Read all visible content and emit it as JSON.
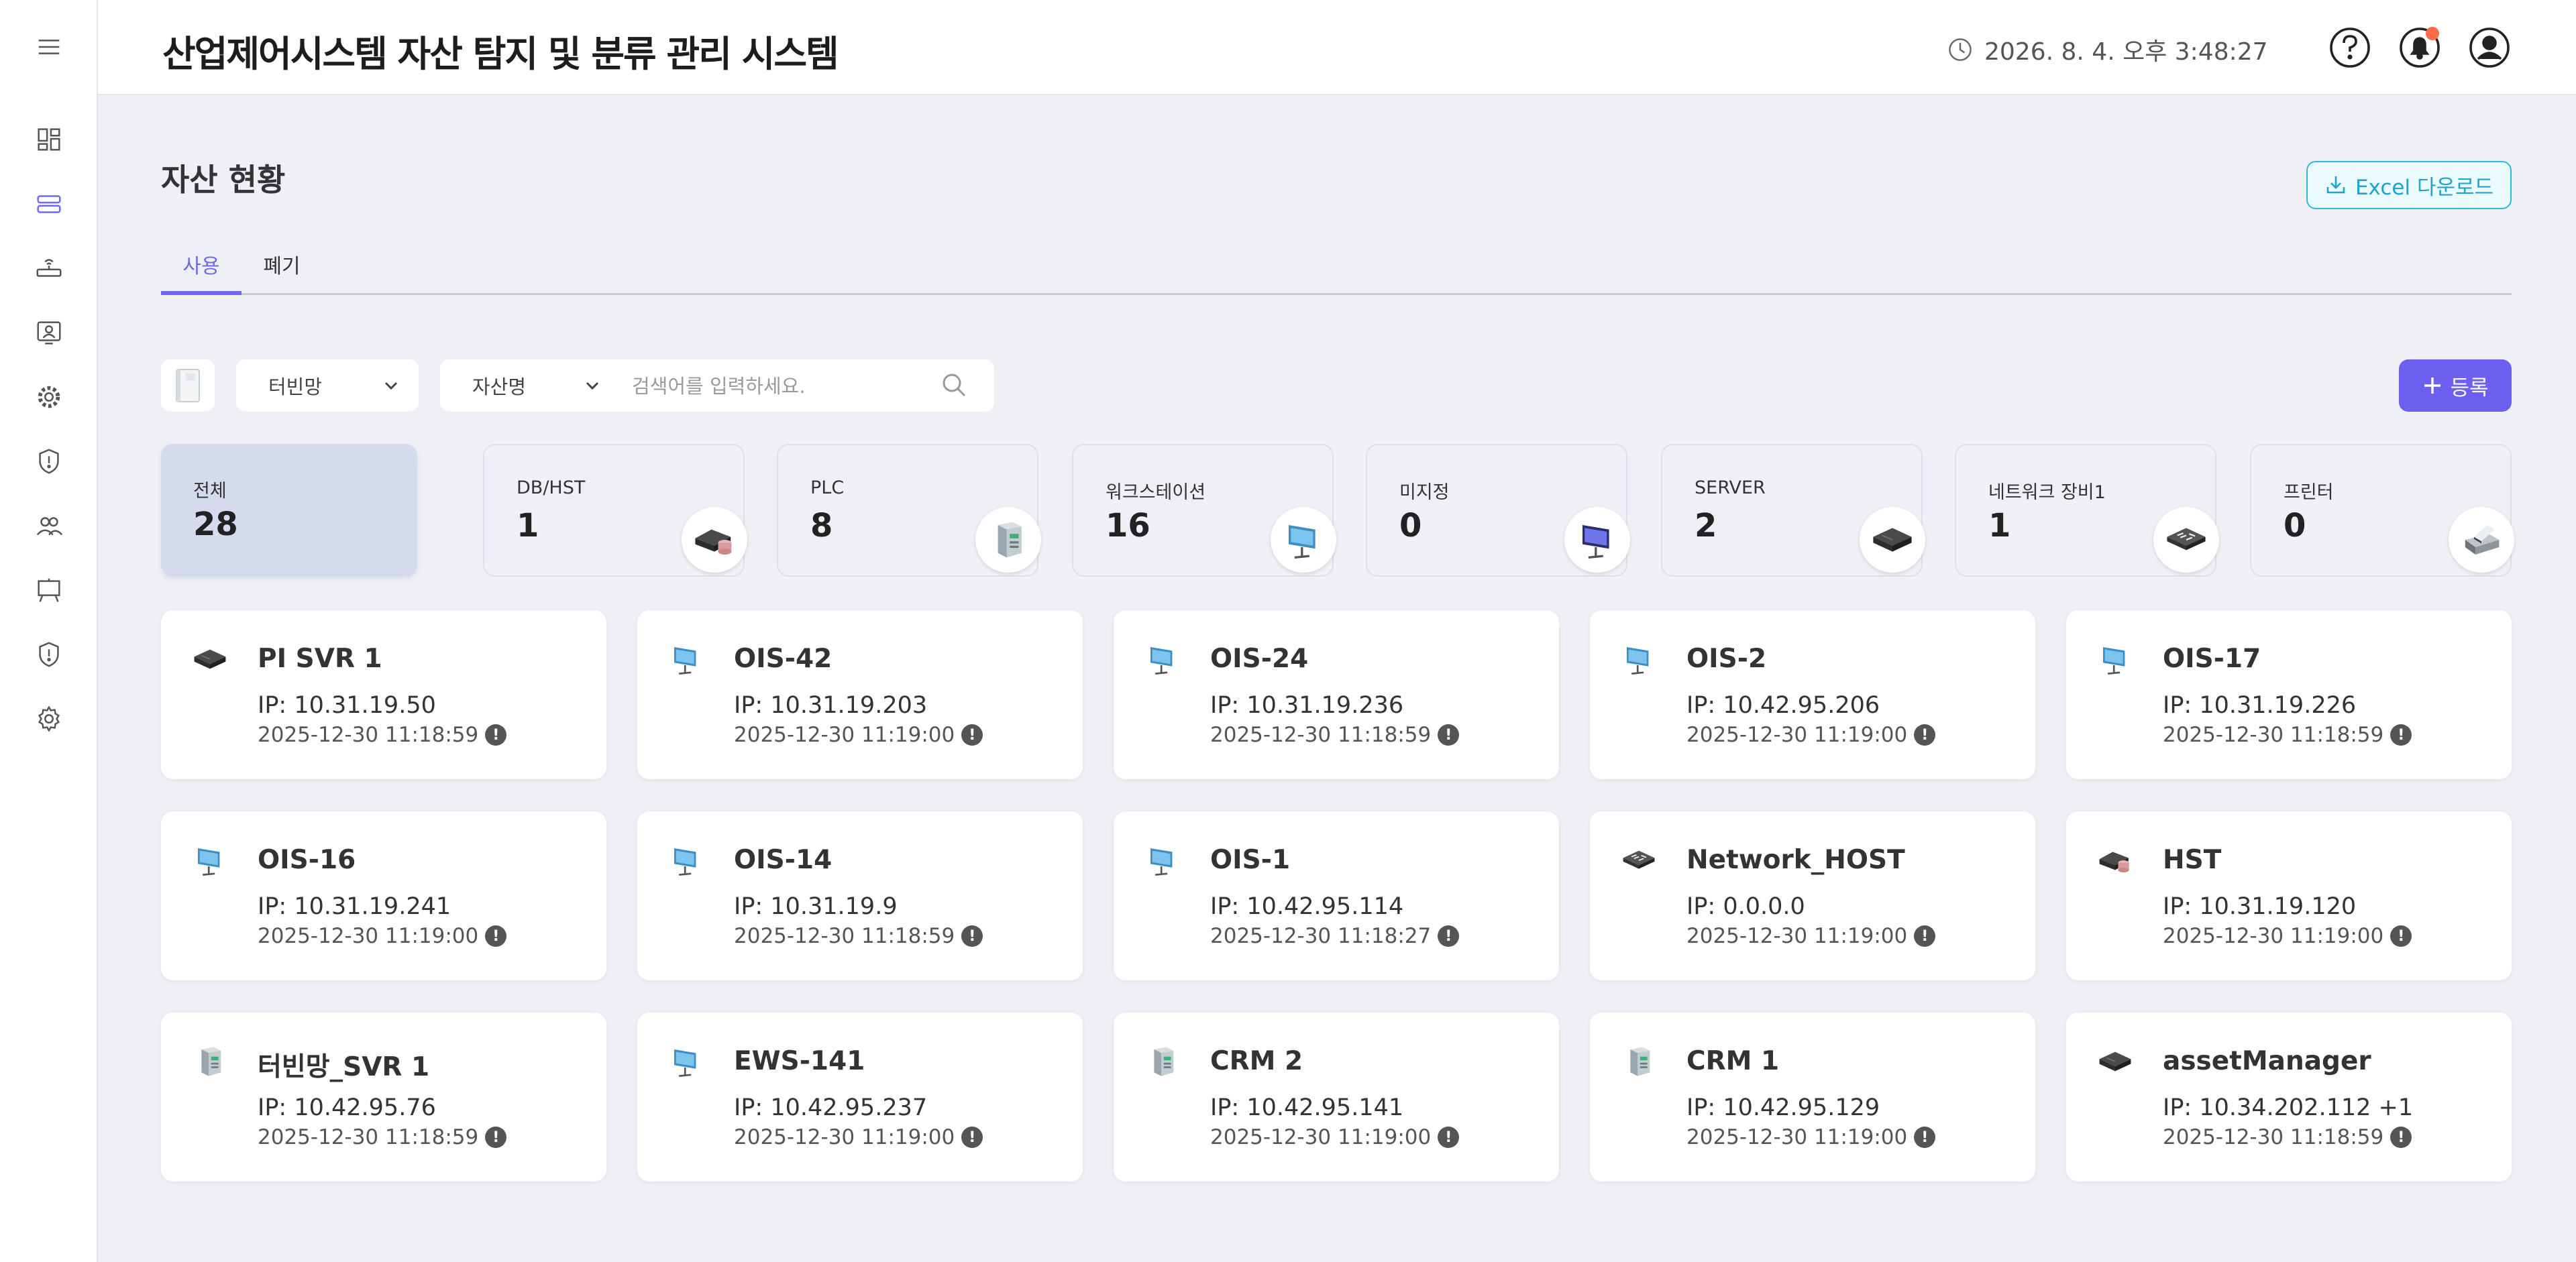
{
  "header": {
    "title": "산업제어시스템 자산 탐지 및 분류 관리 시스템",
    "datetime": "2026. 8. 4. 오후 3:48:27",
    "icons": [
      "menu-icon",
      "clock-icon",
      "help-icon",
      "bell-icon",
      "user-icon"
    ]
  },
  "sidebar": {
    "items": [
      "dashboard-icon",
      "asset-list-icon",
      "network-device-icon",
      "monitor-user-icon",
      "gear-cog-icon",
      "shield-alert-icon",
      "users-icon",
      "board-icon",
      "shield-icon",
      "settings-icon"
    ],
    "active": "asset-list-icon"
  },
  "page": {
    "title": "자산 현황",
    "excel_label": "Excel 다운로드"
  },
  "tabs": [
    {
      "label": "사용",
      "active": true
    },
    {
      "label": "폐기",
      "active": false
    }
  ],
  "filters": {
    "network": "터빈망",
    "field": "자산명",
    "search_placeholder": "검색어를 입력하세요.",
    "register_label": "등록"
  },
  "categories": [
    {
      "label": "전체",
      "count": "28",
      "icon": ""
    },
    {
      "label": "DB/HST",
      "count": "1",
      "icon": "db-hst-icon"
    },
    {
      "label": "PLC",
      "count": "8",
      "icon": "plc-icon"
    },
    {
      "label": "워크스테이션",
      "count": "16",
      "icon": "workstation-icon"
    },
    {
      "label": "미지정",
      "count": "0",
      "icon": "unassigned-monitor-icon"
    },
    {
      "label": "SERVER",
      "count": "2",
      "icon": "server-icon"
    },
    {
      "label": "네트워크 장비1",
      "count": "1",
      "icon": "network-switch-icon"
    },
    {
      "label": "프린터",
      "count": "0",
      "icon": "printer-icon"
    }
  ],
  "assets": [
    {
      "name": "PI SVR 1",
      "ip": "IP: 10.31.19.50",
      "time": "2025-12-30 11:18:59",
      "icon": "server-icon"
    },
    {
      "name": "OIS-42",
      "ip": "IP: 10.31.19.203",
      "time": "2025-12-30 11:19:00",
      "icon": "workstation-icon"
    },
    {
      "name": "OIS-24",
      "ip": "IP: 10.31.19.236",
      "time": "2025-12-30 11:18:59",
      "icon": "workstation-icon"
    },
    {
      "name": "OIS-2",
      "ip": "IP: 10.42.95.206",
      "time": "2025-12-30 11:19:00",
      "icon": "workstation-icon"
    },
    {
      "name": "OIS-17",
      "ip": "IP: 10.31.19.226",
      "time": "2025-12-30 11:18:59",
      "icon": "workstation-icon"
    },
    {
      "name": "OIS-16",
      "ip": "IP: 10.31.19.241",
      "time": "2025-12-30 11:19:00",
      "icon": "workstation-icon"
    },
    {
      "name": "OIS-14",
      "ip": "IP: 10.31.19.9",
      "time": "2025-12-30 11:18:59",
      "icon": "workstation-icon"
    },
    {
      "name": "OIS-1",
      "ip": "IP: 10.42.95.114",
      "time": "2025-12-30 11:18:27",
      "icon": "workstation-icon"
    },
    {
      "name": "Network_HOST",
      "ip": "IP: 0.0.0.0",
      "time": "2025-12-30 11:19:00",
      "icon": "network-switch-icon"
    },
    {
      "name": "HST",
      "ip": "IP: 10.31.19.120",
      "time": "2025-12-30 11:19:00",
      "icon": "db-hst-icon"
    },
    {
      "name": "터빈망_SVR 1",
      "ip": "IP: 10.42.95.76",
      "time": "2025-12-30 11:18:59",
      "icon": "plc-icon"
    },
    {
      "name": "EWS-141",
      "ip": "IP: 10.42.95.237",
      "time": "2025-12-30 11:19:00",
      "icon": "workstation-icon"
    },
    {
      "name": "CRM 2",
      "ip": "IP: 10.42.95.141",
      "time": "2025-12-30 11:19:00",
      "icon": "plc-icon"
    },
    {
      "name": "CRM 1",
      "ip": "IP: 10.42.95.129",
      "time": "2025-12-30 11:19:00",
      "icon": "plc-icon"
    },
    {
      "name": "assetManager",
      "ip": "IP: 10.34.202.112 +1",
      "time": "2025-12-30 11:18:59",
      "icon": "server-icon"
    }
  ],
  "colors": {
    "accent": "#6f68ea",
    "register_bg": "#6f5ff0",
    "excel_border": "#2eb8d8",
    "total_card_bg": "#d6daee",
    "notif_dot": "#ff6b4a",
    "page_bg": "#eef0f5"
  }
}
